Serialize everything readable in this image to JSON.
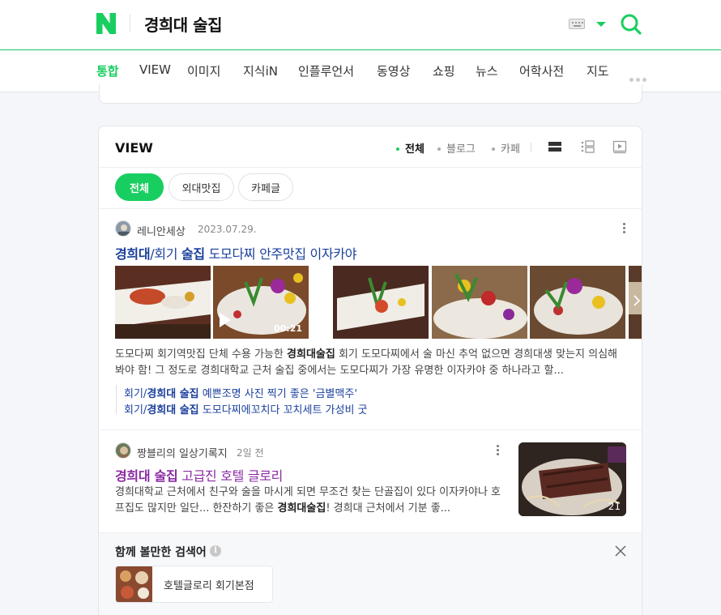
{
  "header": {
    "query": "경희대 술집",
    "accent": "#19ce60"
  },
  "tabs": [
    {
      "label": "통합",
      "active": true
    },
    {
      "label": "VIEW"
    },
    {
      "label": "이미지"
    },
    {
      "label": "지식iN"
    },
    {
      "label": "인플루언서"
    },
    {
      "label": "동영상"
    },
    {
      "label": "쇼핑"
    },
    {
      "label": "뉴스"
    },
    {
      "label": "어학사전"
    },
    {
      "label": "지도"
    }
  ],
  "view_section": {
    "title": "VIEW",
    "filters": [
      {
        "label": "전체",
        "active": true
      },
      {
        "label": "블로그"
      },
      {
        "label": "카페"
      }
    ],
    "chips": [
      {
        "label": "전체",
        "active": true
      },
      {
        "label": "외대맛집"
      },
      {
        "label": "카페글"
      }
    ]
  },
  "posts": [
    {
      "author": "레니안세상",
      "date": "2023.07.29.",
      "title_bold_1": "경희대",
      "title_rest_1": "/회기 ",
      "title_bold_2": "술집",
      "title_rest_2": " 도모다찌 안주맛집 이자카야",
      "video_duration": "00:21",
      "desc_1": "도모다찌 회기역맛집 단체 수용 가능한 ",
      "desc_bold": "경희대술집",
      "desc_2": " 회기 도모다찌에서 술 마신 추억 없으면 경희대생 맞는지 의심해 봐야 함! 그 정도로 경희대학교 근처 술집 중에서는 도모다찌가 가장 유명한 이자카야 중 하나라고 할...",
      "sublinks": [
        {
          "pre": "회기/",
          "bold": "경희대 술집",
          "post": " 예쁜조명 사진 찍기 좋은 '금별맥주'"
        },
        {
          "pre": "회기/",
          "bold": "경희대 술집",
          "post": " 도모다찌에꼬치다 꼬치세트 가성비 굿"
        }
      ]
    },
    {
      "author": "짱블리의 일상기록지",
      "date": "2일 전",
      "title_bold": "경희대 술집",
      "title_rest": " 고급진 호텔 글로리",
      "desc_1": "경희대학교 근처에서 친구와 술을 마시게 되면 무조건 찾는 단골집이 있다 이자카야나 호프집도 많지만 일단... 한잔하기 좋은 ",
      "desc_bold": "경희대술집",
      "desc_2": "! 경희대 근처에서 기분 좋...",
      "image_count": "21"
    }
  ],
  "related": {
    "title": "함께 볼만한 검색어",
    "items": [
      {
        "label": "호텔글로리 회기본점"
      }
    ]
  }
}
